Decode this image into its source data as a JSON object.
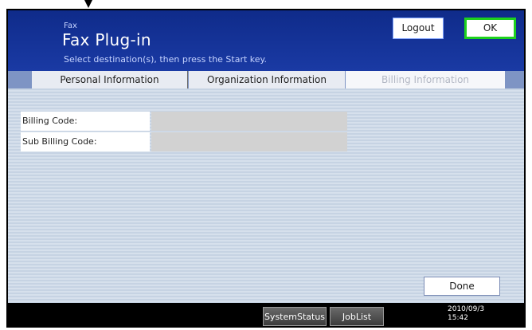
{
  "header": {
    "app_label": "Fax",
    "app_title": "Fax Plug-in",
    "instruction": "Select destination(s), then press the Start key.",
    "logout_label": "Logout",
    "ok_label": "OK"
  },
  "tabs": [
    {
      "label": "Personal Information",
      "state": "normal"
    },
    {
      "label": "Organization Information",
      "state": "normal"
    },
    {
      "label": "Billing Information",
      "state": "selected"
    }
  ],
  "form": {
    "fields": [
      {
        "label": "Billing Code:",
        "value": ""
      },
      {
        "label": "Sub Billing Code:",
        "value": ""
      }
    ]
  },
  "done_label": "Done",
  "status_bar": {
    "system_status_label": "SystemStatus",
    "job_list_label": "JobList",
    "date": "2010/09/3",
    "time": "15:42"
  },
  "colors": {
    "header_blue": "#0f2b8a",
    "ok_border": "#1ed11e",
    "field_gray": "#d2d2d2"
  }
}
